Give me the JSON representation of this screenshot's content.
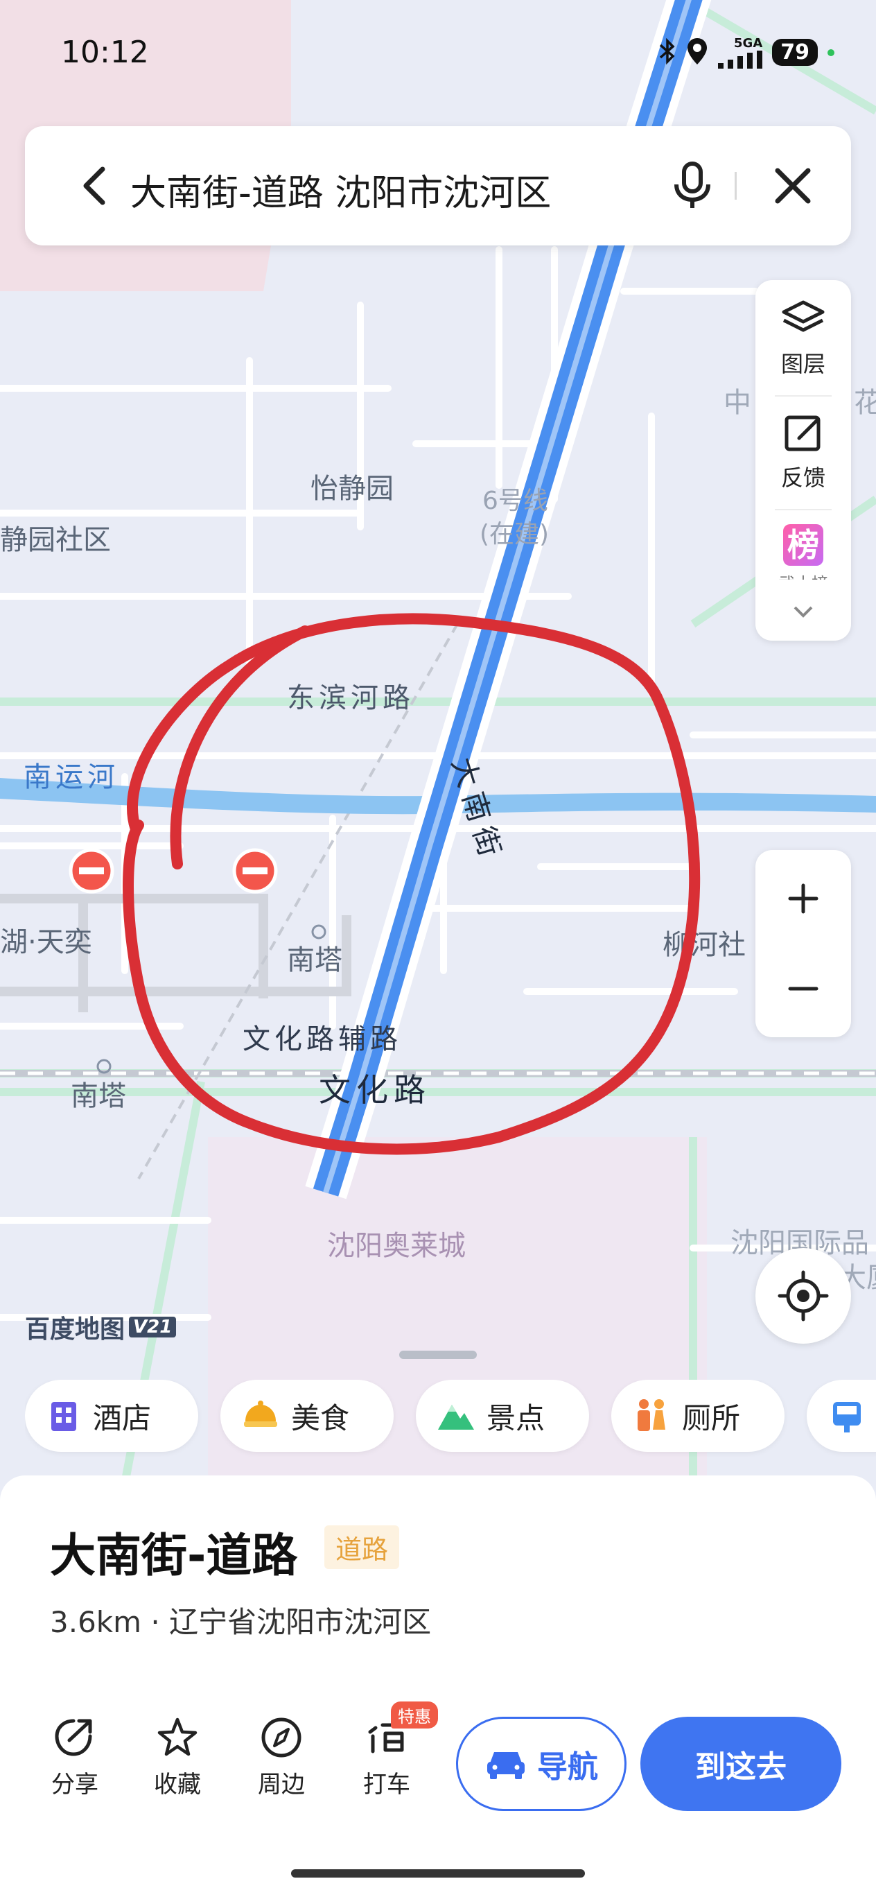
{
  "status_bar": {
    "time": "10:12",
    "network": "5GA",
    "battery": "79",
    "icons": [
      "bluetooth-icon",
      "location-icon",
      "signal-icon",
      "battery-icon"
    ]
  },
  "search": {
    "query": "大南街-道路 沈阳市沈河区",
    "icons": [
      "back-icon",
      "microphone-icon",
      "close-icon"
    ]
  },
  "map": {
    "labels": {
      "yijingyuan": "怡静园",
      "yijingyuan_community": "静园社区",
      "metro": "6号线",
      "metro_status": "(在建)",
      "dongbinhe_road": "东滨河路",
      "nanyunhe": "南运河",
      "dananjie": "大南街",
      "hu_tianyi": "湖·天奕",
      "nanta_station": "南塔",
      "nanta": "南塔",
      "liuhe_community": "柳河社",
      "wenhua_aux_road": "文化路辅路",
      "wenhua_road": "文化路",
      "outlets": "沈阳奥莱城",
      "intl_building_1": "沈阳国际品",
      "intl_building_2": "大厦",
      "right_edge_1": "中",
      "right_edge_2": "花"
    },
    "colors": {
      "background": "#e9ecf6",
      "road": "#ffffff",
      "river": "#8cc4f2",
      "highlight_road": "#4a8ff0",
      "annotation": "#d92f35",
      "green_line": "#bfe8d6"
    }
  },
  "tools": {
    "layers": {
      "label": "图层",
      "icon": "layers-icon"
    },
    "feedback": {
      "label": "反馈",
      "icon": "edit-icon"
    },
    "ranking": {
      "label": "榜",
      "icon": "ranking-icon",
      "sub": "武士榜"
    },
    "more_icon": "chevron-down-icon",
    "zoom_in_icon": "plus-icon",
    "zoom_out_icon": "minus-icon",
    "locate_icon": "locate-icon"
  },
  "watermark": {
    "text": "百度地图",
    "version": "V21"
  },
  "categories": [
    {
      "label": "酒店",
      "icon": "hotel-icon",
      "color": "#6a5ce6"
    },
    {
      "label": "美食",
      "icon": "food-icon",
      "color": "#f2a81e"
    },
    {
      "label": "景点",
      "icon": "scenic-icon",
      "color": "#35c07d"
    },
    {
      "label": "厕所",
      "icon": "toilet-icon",
      "color": "#f07a3e"
    }
  ],
  "place": {
    "title": "大南街-道路",
    "tag": "道路",
    "distance": "3.6km",
    "separator": "·",
    "address": "辽宁省沈阳市沈河区"
  },
  "actions": {
    "share": {
      "label": "分享",
      "icon": "share-icon"
    },
    "favorite": {
      "label": "收藏",
      "icon": "star-icon"
    },
    "nearby": {
      "label": "周边",
      "icon": "compass-icon"
    },
    "taxi": {
      "label": "打车",
      "icon": "taxi-icon",
      "badge": "特惠"
    },
    "navigate": {
      "label": "导航",
      "icon": "car-icon"
    },
    "go_here": {
      "label": "到这去"
    }
  }
}
